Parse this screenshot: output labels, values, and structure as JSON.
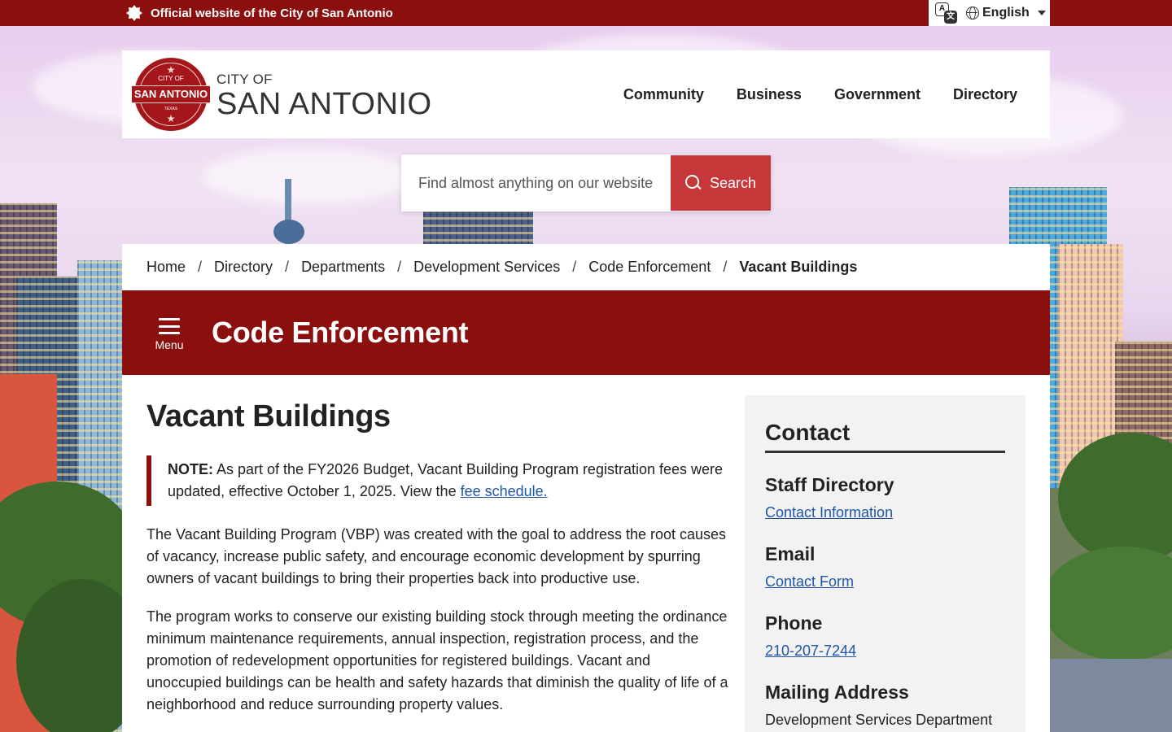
{
  "topbar": {
    "official": "Official website of the City of San Antonio",
    "language": "English",
    "translate_a": "A",
    "translate_b": "文"
  },
  "header": {
    "seal_top": "CITY OF",
    "seal_main": "SAN ANTONIO",
    "seal_bottom": "TEXAS",
    "brand_small": "CITY OF",
    "brand_large": "SAN ANTONIO",
    "nav": [
      "Community",
      "Business",
      "Government",
      "Directory"
    ]
  },
  "search": {
    "placeholder": "Find almost anything on our website",
    "button": "Search"
  },
  "breadcrumb": {
    "items": [
      "Home",
      "Directory",
      "Departments",
      "Development Services",
      "Code Enforcement"
    ],
    "separator": "/",
    "current": "Vacant Buildings"
  },
  "section": {
    "menu_label": "Menu",
    "title": "Code Enforcement"
  },
  "main": {
    "title": "Vacant Buildings",
    "note_label": "NOTE:",
    "note_text": " As part of the FY2026 Budget, Vacant Building Program registration fees were updated, effective October 1, 2025. View the ",
    "note_link": "fee schedule.",
    "para1": "The Vacant Building Program (VBP) was created with the goal to address the root causes of vacancy, increase public safety, and encourage economic development by spurring owners of vacant buildings to bring their properties back into productive use.",
    "para2": "The program works to conserve our existing building stock through meeting the ordinance minimum maintenance requirements, annual inspection, registration process, and the promotion of redevelopment opportunities for registered buildings. Vacant and unoccupied buildings can be health and safety hazards that diminish the quality of life of a neighborhood and reduce surrounding property values."
  },
  "contact": {
    "title": "Contact",
    "staff_heading": "Staff Directory",
    "staff_link": "Contact Information",
    "email_heading": "Email",
    "email_link": "Contact Form",
    "phone_heading": "Phone",
    "phone_link": "210-207-7244",
    "mail_heading": "Mailing Address",
    "mail_line1": "Development Services Department"
  },
  "colors": {
    "brand_red": "#8b0f0c",
    "search_button": "#c6373a",
    "link": "#1f56a6"
  }
}
